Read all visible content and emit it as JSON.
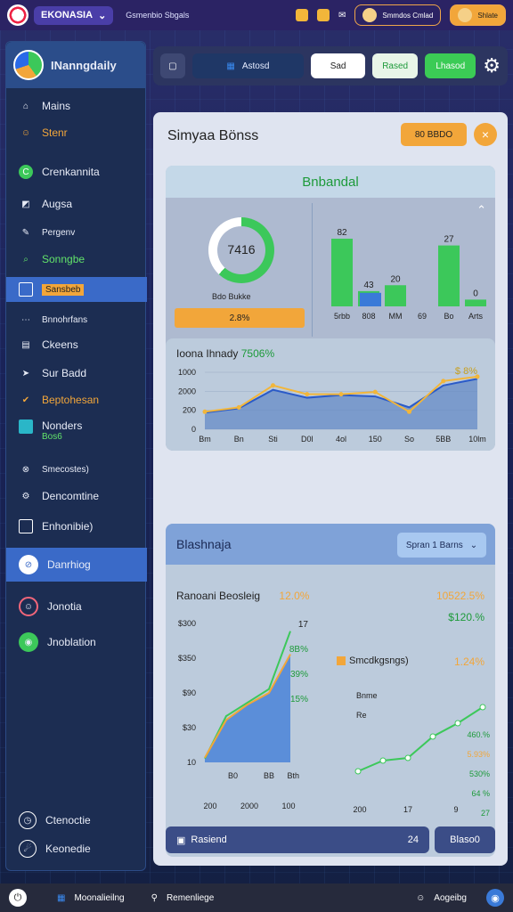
{
  "topbar": {
    "brand": "EKONASIA",
    "subtitle": "Gsmenbio Sbgals",
    "pill1": "Smmdos Cmlad",
    "pill2": "Shlate"
  },
  "sidebar": {
    "header": "INanngdaily",
    "items": [
      {
        "label": "Mains"
      },
      {
        "label": "Stenr"
      },
      {
        "label": "Crenkannita"
      },
      {
        "label": "Augsa"
      },
      {
        "label": "Pergenv"
      },
      {
        "label": "Sonngbe"
      },
      {
        "label": "Sansbeb"
      },
      {
        "label": "Bnnohrfans"
      },
      {
        "label": "Ckeens"
      },
      {
        "label": "Sur Badd"
      },
      {
        "label": "Beptohesan"
      },
      {
        "label": "Nonders"
      },
      {
        "label": "Bos6"
      },
      {
        "label": "Smecostes)"
      },
      {
        "label": "Dencomtine"
      },
      {
        "label": "Enhonibie)"
      },
      {
        "label": "Danrhiog"
      },
      {
        "label": "Jonotia"
      },
      {
        "label": "Jnoblation"
      },
      {
        "label": "Ctenoctie"
      },
      {
        "label": "Keonedie"
      }
    ]
  },
  "toolbar": {
    "dark_label": "Astosd",
    "white_label": "Sad",
    "light_label": "Rased",
    "green_label": "Lhasod"
  },
  "panel": {
    "title": "Simyaa Bönss",
    "action": "80 BBDO",
    "close": "×"
  },
  "card1": {
    "title": "Bnbandal",
    "donut_value": "7416",
    "donut_sub": "Bdo Bukke",
    "orange_label": "2.8%",
    "subcard_title": "Ioona Ihnady",
    "subcard_value": "7506%"
  },
  "card2": {
    "title": "Blashnaja",
    "select_label": "Spran 1 Barns",
    "sub_title": "Ranoani Beosleig",
    "sub_pct1": "12.0%",
    "sub_pct2": "10522.5%",
    "right_label": "Smcdkgsngs)",
    "right_pct": "1.24%",
    "right_pct2": "$120.%",
    "footer_label": "Rasiend",
    "footer_value": "24",
    "footer_btn": "Blaso0"
  },
  "bottombar": {
    "item1": "Moonalieilng",
    "item2": "Remenliege",
    "item3": "Aogeibg"
  },
  "chart_data": [
    {
      "type": "bar",
      "categories": [
        "5rbb",
        "808",
        "MM",
        "69",
        "Bo",
        "Arts"
      ],
      "series": [
        {
          "values": [
            80,
            18,
            25,
            0,
            72,
            8
          ]
        },
        {
          "values": [
            0,
            16,
            0,
            0,
            0,
            0
          ]
        }
      ],
      "data_labels": [
        "82",
        "43",
        "20",
        "27",
        "0"
      ]
    },
    {
      "type": "line",
      "x": [
        "Bm",
        "Bn",
        "Sti",
        "D0l",
        "4ol",
        "150",
        "So",
        "5BB",
        "10lm"
      ],
      "y_ticks": [
        "1000",
        "2000",
        "200",
        "0"
      ],
      "corner_label": "$ 8%",
      "series": [
        {
          "values": [
            0.4,
            0.5,
            1.0,
            0.8,
            0.8,
            0.85,
            0.4,
            1.1,
            1.2
          ]
        },
        {
          "values": [
            0.38,
            0.48,
            0.9,
            0.72,
            0.78,
            0.75,
            0.5,
            1.0,
            1.15
          ]
        }
      ]
    },
    {
      "type": "area",
      "x": [
        "200",
        "2000",
        "100"
      ],
      "y_ticks": [
        "$300",
        "$350",
        "$90",
        "$30",
        "10"
      ],
      "series": [
        {
          "values": [
            10,
            120,
            155,
            190,
            340
          ]
        },
        {
          "values": [
            12,
            110,
            150,
            180,
            280
          ]
        }
      ],
      "labels": [
        "17",
        "8B%",
        "39%",
        "15%"
      ],
      "legend": [
        "B0",
        "BB"
      ],
      "caption": "Bth"
    },
    {
      "type": "line",
      "x": [
        "200",
        "17",
        "9"
      ],
      "series": [
        {
          "values": [
            20,
            40,
            45,
            85,
            110,
            140
          ]
        }
      ],
      "labels": [
        "Bnme",
        "Re",
        "460.%",
        "5.93%",
        "530%",
        "64 %",
        "27"
      ]
    }
  ]
}
